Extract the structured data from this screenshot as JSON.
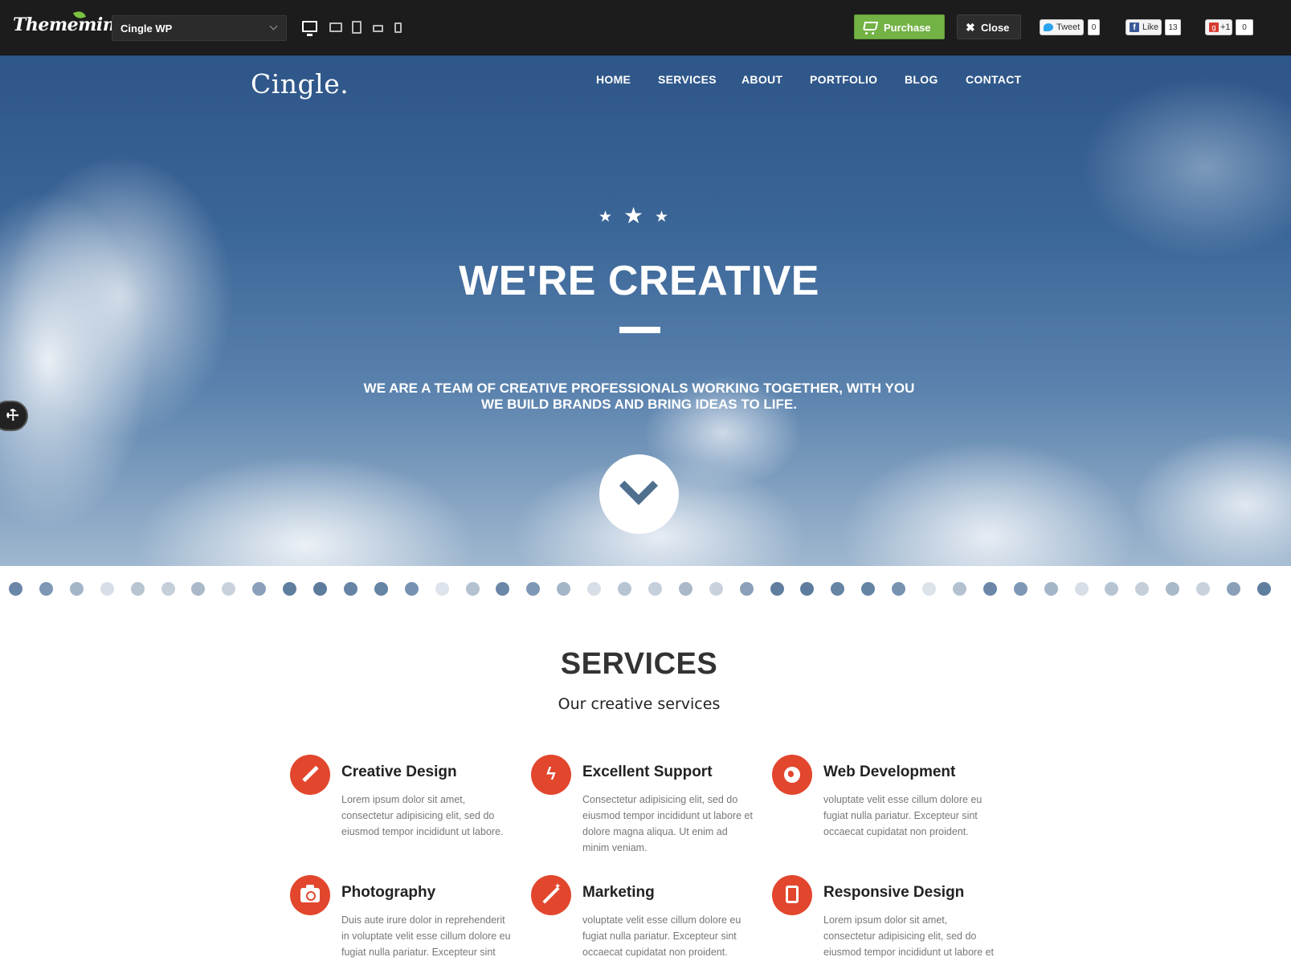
{
  "topbar": {
    "brand": "Thememints",
    "theme_select": "Cingle WP",
    "devices": [
      "desktop",
      "tablet-landscape",
      "tablet-portrait",
      "phone-landscape",
      "phone-portrait"
    ],
    "purchase_label": "Purchase",
    "close_label": "Close",
    "social": {
      "tweet_label": "Tweet",
      "tweet_count": "0",
      "like_label": "Like",
      "like_count": "13",
      "plus_label": "+1",
      "plus_count": "0"
    }
  },
  "hero": {
    "logo": "Cingle.",
    "nav": [
      "HOME",
      "SERVICES",
      "ABOUT",
      "PORTFOLIO",
      "BLOG",
      "CONTACT"
    ],
    "title": "WE'RE CREATIVE",
    "subtitle": "WE ARE A TEAM OF CREATIVE PROFESSIONALS WORKING TOGETHER, WITH YOU WE BUILD BRANDS AND BRING IDEAS TO LIFE."
  },
  "services": {
    "title": "SERVICES",
    "subtitle": "Our creative services",
    "items": [
      {
        "name": "Creative Design",
        "icon": "pencil-icon",
        "desc": "Lorem ipsum dolor sit amet, consectetur adipisicing elit, sed do eiusmod tempor incididunt ut labore."
      },
      {
        "name": "Excellent Support",
        "icon": "bolt-icon",
        "desc": "Consectetur adipisicing elit, sed do eiusmod tempor incididunt ut labore et dolore magna aliqua. Ut enim ad minim veniam."
      },
      {
        "name": "Web Development",
        "icon": "globe-icon",
        "desc": "voluptate velit esse cillum dolore eu fugiat nulla pariatur. Excepteur sint occaecat cupidatat non proident."
      },
      {
        "name": "Photography",
        "icon": "camera-icon",
        "desc": "Duis aute irure dolor in reprehenderit in voluptate velit esse cillum dolore eu fugiat nulla pariatur. Excepteur sint occaecat."
      },
      {
        "name": "Marketing",
        "icon": "magic-wand-icon",
        "desc": "voluptate velit esse cillum dolore eu fugiat nulla pariatur. Excepteur sint occaecat cupidatat non proident."
      },
      {
        "name": "Responsive Design",
        "icon": "tablet-icon",
        "desc": "Lorem ipsum dolor sit amet, consectetur adipisicing elit, sed do eiusmod tempor incididunt ut labore et dolore."
      }
    ]
  },
  "colors": {
    "accent": "#e2462d",
    "purchase_green": "#73b244",
    "topbar_bg": "#1c1c1c",
    "sky_blue": "#3b6698"
  }
}
